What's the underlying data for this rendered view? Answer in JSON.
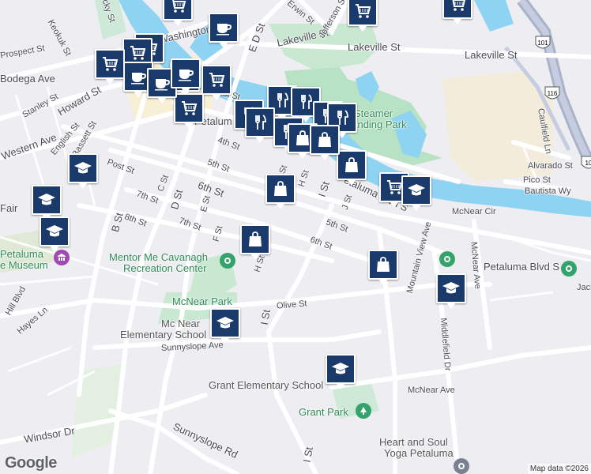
{
  "map": {
    "streets": [
      {
        "name": "Keokuk St"
      },
      {
        "name": "Prospect St"
      },
      {
        "name": "Bodega Ave"
      },
      {
        "name": "Washington St"
      },
      {
        "name": "Howard St"
      },
      {
        "name": "Stanley St"
      },
      {
        "name": "Western Ave"
      },
      {
        "name": "English St"
      },
      {
        "name": "Post St"
      },
      {
        "name": "C St"
      },
      {
        "name": "B St"
      },
      {
        "name": "7th St"
      },
      {
        "name": "8th St"
      },
      {
        "name": "D St"
      },
      {
        "name": "6th St"
      },
      {
        "name": "E St"
      },
      {
        "name": "F St"
      },
      {
        "name": "4th St"
      },
      {
        "name": "5th St"
      },
      {
        "name": "1st St"
      },
      {
        "name": "G St"
      },
      {
        "name": "H St"
      },
      {
        "name": "I St"
      },
      {
        "name": "J St"
      },
      {
        "name": "E D St"
      },
      {
        "name": "Lakeville St"
      },
      {
        "name": "Erwin St"
      },
      {
        "name": "Jefferson St"
      },
      {
        "name": "Petaluma Blvd S"
      },
      {
        "name": "McNear Ave"
      },
      {
        "name": "McNear Cir"
      },
      {
        "name": "Olive St"
      },
      {
        "name": "Sunnyslope Ave"
      },
      {
        "name": "Sunnyslope Rd"
      },
      {
        "name": "Windsor Dr"
      },
      {
        "name": "Hayes Ln"
      },
      {
        "name": "Middlefield Dr"
      },
      {
        "name": "Alvarado St"
      },
      {
        "name": "Pico St"
      },
      {
        "name": "Bautista Wy"
      },
      {
        "name": "Caulfield Ln"
      },
      {
        "name": "Jack"
      },
      {
        "name": "Fair"
      },
      {
        "name": "Hill Blvd"
      },
      {
        "name": "Bassett St"
      },
      {
        "name": "Lucky St"
      },
      {
        "name": "Mountain View Ave"
      }
    ],
    "labels": {
      "petaluma": "Petalum",
      "museum": "Petaluma Historical Museum",
      "museum_line1": "Petaluma",
      "museum_line2": "e Museum",
      "steamer": "Steamer",
      "landing_park": "Landing Park",
      "mentor": "Mentor Me Cavanagh",
      "recreation": "Recreation Center",
      "mcnear_park": "McNear Park",
      "mcnear_school_1": "Mc Near",
      "mcnear_school_2": "Elementary School",
      "grant_school": "Grant Elementary School",
      "grant_park": "Grant Park",
      "heart_soul_1": "Heart and Soul",
      "heart_soul_2": "Yoga Petaluma",
      "pho_blvd": "Petaluma Blvd S",
      "pho_blvd2": "Petaluma Blvd S"
    },
    "highway_shields": [
      "101",
      "116",
      "10"
    ],
    "colors": {
      "water": "#8fd3f2",
      "park": "#b7e2c4",
      "road": "#ffffff",
      "pin": "#1a3a6b",
      "land": "#eeeef2",
      "highway": "#a9b3c9"
    }
  },
  "pins": [
    {
      "type": "grocery",
      "icon": "cart-icon"
    },
    {
      "type": "grocery",
      "icon": "cart-icon"
    },
    {
      "type": "grocery",
      "icon": "cart-icon"
    },
    {
      "type": "grocery",
      "icon": "cart-icon"
    },
    {
      "type": "grocery",
      "icon": "cart-icon"
    },
    {
      "type": "grocery",
      "icon": "cart-icon"
    },
    {
      "type": "grocery",
      "icon": "cart-icon"
    },
    {
      "type": "grocery",
      "icon": "cart-icon"
    },
    {
      "type": "grocery",
      "icon": "cart-icon"
    },
    {
      "type": "grocery",
      "icon": "cart-icon"
    },
    {
      "type": "cafe",
      "icon": "coffee-icon"
    },
    {
      "type": "cafe",
      "icon": "coffee-icon"
    },
    {
      "type": "cafe",
      "icon": "coffee-icon"
    },
    {
      "type": "cafe",
      "icon": "coffee-icon"
    },
    {
      "type": "restaurant",
      "icon": "fork-knife-icon"
    },
    {
      "type": "restaurant",
      "icon": "fork-knife-icon"
    },
    {
      "type": "restaurant",
      "icon": "fork-knife-icon"
    },
    {
      "type": "restaurant",
      "icon": "fork-knife-icon"
    },
    {
      "type": "restaurant",
      "icon": "fork-knife-icon"
    },
    {
      "type": "restaurant",
      "icon": "fork-knife-icon"
    },
    {
      "type": "restaurant",
      "icon": "fork-knife-icon"
    },
    {
      "type": "shopping",
      "icon": "shopping-bag-icon"
    },
    {
      "type": "shopping",
      "icon": "shopping-bag-icon"
    },
    {
      "type": "shopping",
      "icon": "shopping-bag-icon"
    },
    {
      "type": "shopping",
      "icon": "shopping-bag-icon"
    },
    {
      "type": "shopping",
      "icon": "shopping-bag-icon"
    },
    {
      "type": "shopping",
      "icon": "shopping-bag-icon"
    },
    {
      "type": "school",
      "icon": "graduation-cap-icon"
    },
    {
      "type": "school",
      "icon": "graduation-cap-icon"
    },
    {
      "type": "school",
      "icon": "graduation-cap-icon"
    },
    {
      "type": "school",
      "icon": "graduation-cap-icon"
    },
    {
      "type": "school",
      "icon": "graduation-cap-icon"
    },
    {
      "type": "school",
      "icon": "graduation-cap-icon"
    },
    {
      "type": "school",
      "icon": "graduation-cap-icon"
    }
  ],
  "footer": {
    "google": "Google",
    "attribution": "Map data ©2026"
  }
}
